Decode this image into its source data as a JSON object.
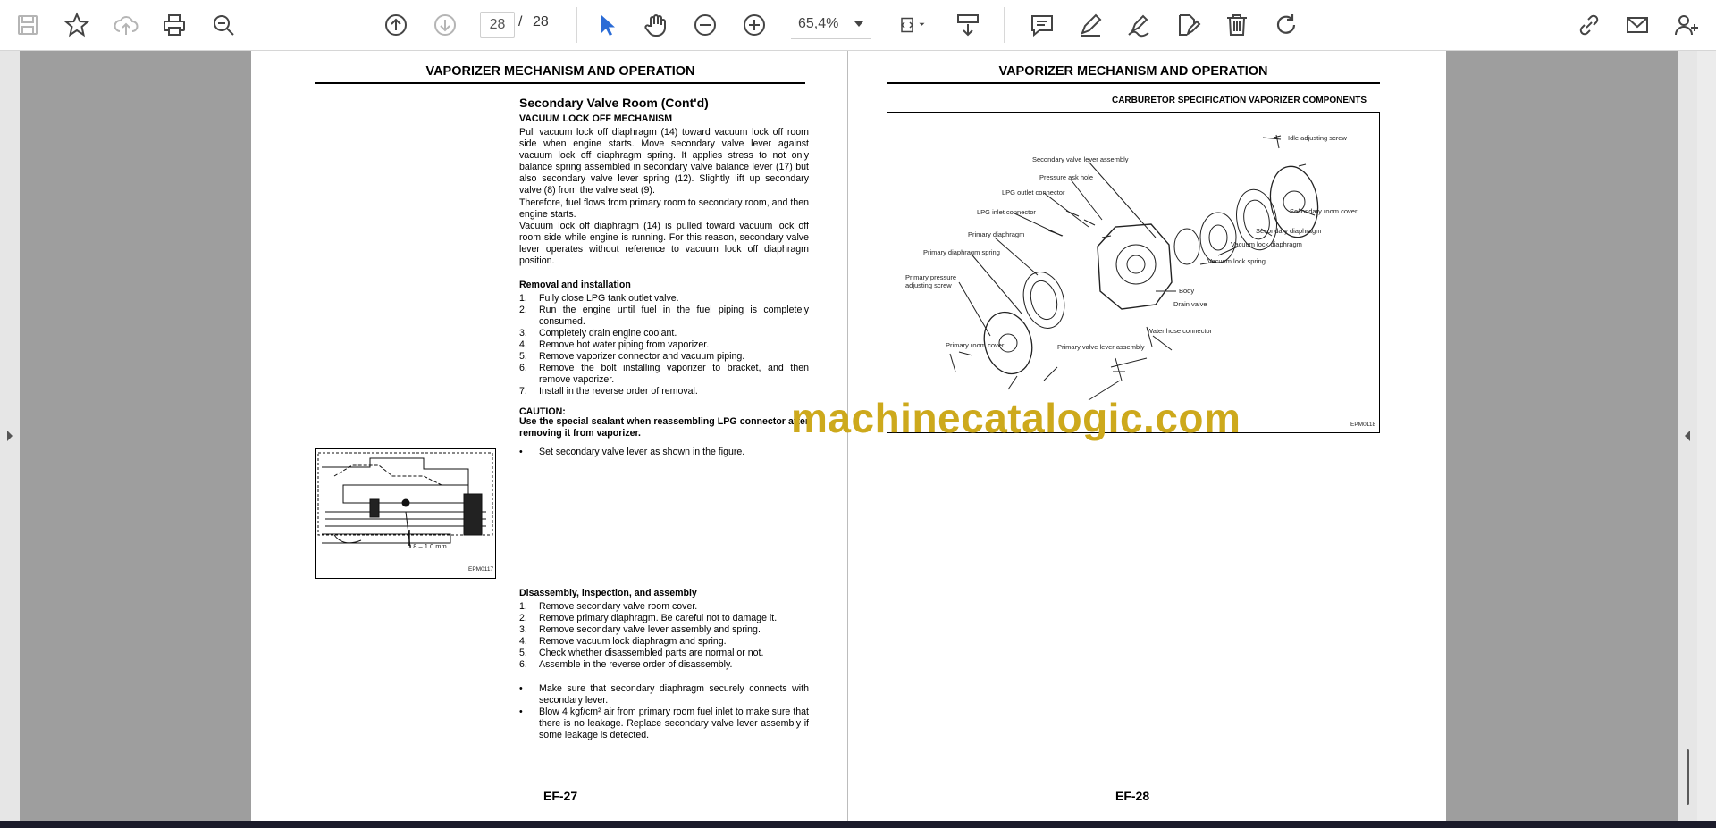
{
  "toolbar": {
    "current_page": "28",
    "page_separator": "/",
    "total_pages": "28",
    "zoom_level": "65,4%"
  },
  "left_page": {
    "header": "VAPORIZER MECHANISM AND OPERATION",
    "section_title": "Secondary Valve Room (Cont'd)",
    "subsection": "VACUUM LOCK OFF MECHANISM",
    "paragraph1": "Pull vacuum lock off diaphragm (14) toward vacuum lock off room side when engine starts. Move secondary valve lever against vacuum lock off diaphragm spring. It applies stress to not only balance spring assembled in secondary valve balance lever (17) but also secondary valve lever spring (12). Slightly lift up secondary valve (8) from the valve seat (9).",
    "paragraph2": "Therefore, fuel flows from primary room to secondary room, and then engine starts.",
    "paragraph3": "Vacuum lock off diaphragm (14) is pulled toward vacuum lock off room side while engine is running. For this reason, secondary valve lever operates without reference to vacuum lock off diaphragm position.",
    "removal_title": "Removal and installation",
    "removal_steps": [
      "Fully close LPG tank outlet valve.",
      "Run the engine until fuel in the fuel piping is completely consumed.",
      "Completely drain engine coolant.",
      "Remove hot water piping from vaporizer.",
      "Remove vaporizer connector and vacuum piping.",
      "Remove the bolt installing vaporizer to bracket, and then remove vaporizer.",
      "Install in the reverse order of removal."
    ],
    "caution_title": "CAUTION:",
    "caution_text": "Use the special sealant when reassembling LPG connector after removing it from vaporizer.",
    "bullet_set": "Set secondary valve lever as shown in the figure.",
    "figure_dim": "0.8 – 1.0 mm",
    "figure_code": "EPM0117",
    "disassembly_title": "Disassembly, inspection, and assembly",
    "disassembly_steps": [
      "Remove secondary valve room cover.",
      "Remove primary diaphragm. Be careful not to damage it.",
      "Remove secondary valve lever assembly and spring.",
      "Remove vacuum lock diaphragm and spring.",
      "Check whether disassembled parts are normal or not.",
      "Assemble in the reverse order of disassembly."
    ],
    "bullet_make_sure": "Make sure that secondary diaphragm securely connects with secondary lever.",
    "bullet_blow": "Blow 4 kgf/cm² air from primary room fuel inlet to make sure that there is no leakage. Replace secondary valve lever assembly if some leakage is detected.",
    "page_number": "EF-27"
  },
  "right_page": {
    "header": "VAPORIZER MECHANISM AND OPERATION",
    "subheader": "CARBURETOR SPECIFICATION VAPORIZER COMPONENTS",
    "labels": {
      "idle_screw": "Idle adjusting screw",
      "sec_lever": "Secondary valve lever assembly",
      "pressure_hole": "Pressure ask hole",
      "lpg_outlet": "LPG outlet connector",
      "lpg_inlet": "LPG inlet connector",
      "sec_cover": "Secondary room cover",
      "sec_diaphragm": "Secondary diaphragm",
      "vac_diaphragm": "Vacuum lock diaphragm",
      "vac_spring": "Vacuum lock spring",
      "primary_diaphragm": "Primary diaphragm",
      "primary_spring": "Primary diaphragm spring",
      "body": "Body",
      "primary_screw": "Primary pressure adjusting screw",
      "drain_valve": "Drain valve",
      "water_hose": "Water hose connector",
      "primary_cover": "Primary room cover",
      "primary_valve": "Primary valve lever assembly"
    },
    "figure_code": "EPM0118",
    "page_number": "EF-28"
  },
  "watermark": "machinecatalogic.com"
}
